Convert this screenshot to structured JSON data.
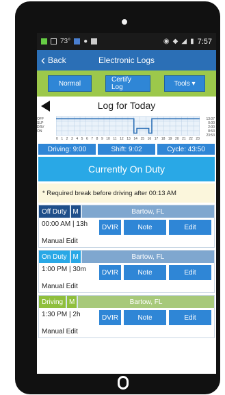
{
  "status_bar": {
    "temp": "73°",
    "time": "7:57"
  },
  "appbar": {
    "back_label": "Back",
    "title": "Electronic Logs"
  },
  "toolbar": {
    "normal_label": "Normal",
    "certify_label": "Certify Log",
    "tools_label": "Tools ▾"
  },
  "log": {
    "title": "Log for Today",
    "graph": {
      "row_labels": [
        "OFF",
        "SLP",
        "DRV",
        "ON"
      ],
      "hour_ticks": [
        "0",
        "1",
        "2",
        "3",
        "4",
        "5",
        "6",
        "7",
        "8",
        "9",
        "10",
        "11",
        "12",
        "13",
        "14",
        "15",
        "16",
        "17",
        "18",
        "19",
        "20",
        "21",
        "22",
        "23"
      ],
      "totals": [
        "13:07",
        "0:00",
        "2:00",
        "8:53",
        "23:53"
      ]
    },
    "stats": {
      "driving": "Driving: 9:00",
      "shift": "Shift: 9:02",
      "cycle": "Cycle: 43:50"
    },
    "current_status": "Currently On Duty",
    "notice": "* Required break before driving after 00:13 AM"
  },
  "entries": [
    {
      "status": "Off Duty",
      "m": "M",
      "location": "Bartow, FL",
      "time": "00:00 AM | 13h",
      "dvir": "DVIR",
      "note": "Note",
      "edit": "Edit",
      "manual": "Manual Edit"
    },
    {
      "status": "On Duty",
      "m": "M",
      "location": "Bartow, FL",
      "time": "1:00 PM | 30m",
      "dvir": "DVIR",
      "note": "Note",
      "edit": "Edit",
      "manual": "Manual Edit"
    },
    {
      "status": "Driving",
      "m": "M",
      "location": "Bartow, FL",
      "time": "1:30 PM | 2h",
      "dvir": "DVIR",
      "note": "Note",
      "edit": "Edit",
      "manual": "Manual Edit"
    }
  ],
  "colors": {
    "appbar": "#2b6fb6",
    "toolbar": "#9cc84b",
    "button": "#2f86d6",
    "onduty_banner": "#29a8e6",
    "notice_bg": "#fbf6dc"
  }
}
